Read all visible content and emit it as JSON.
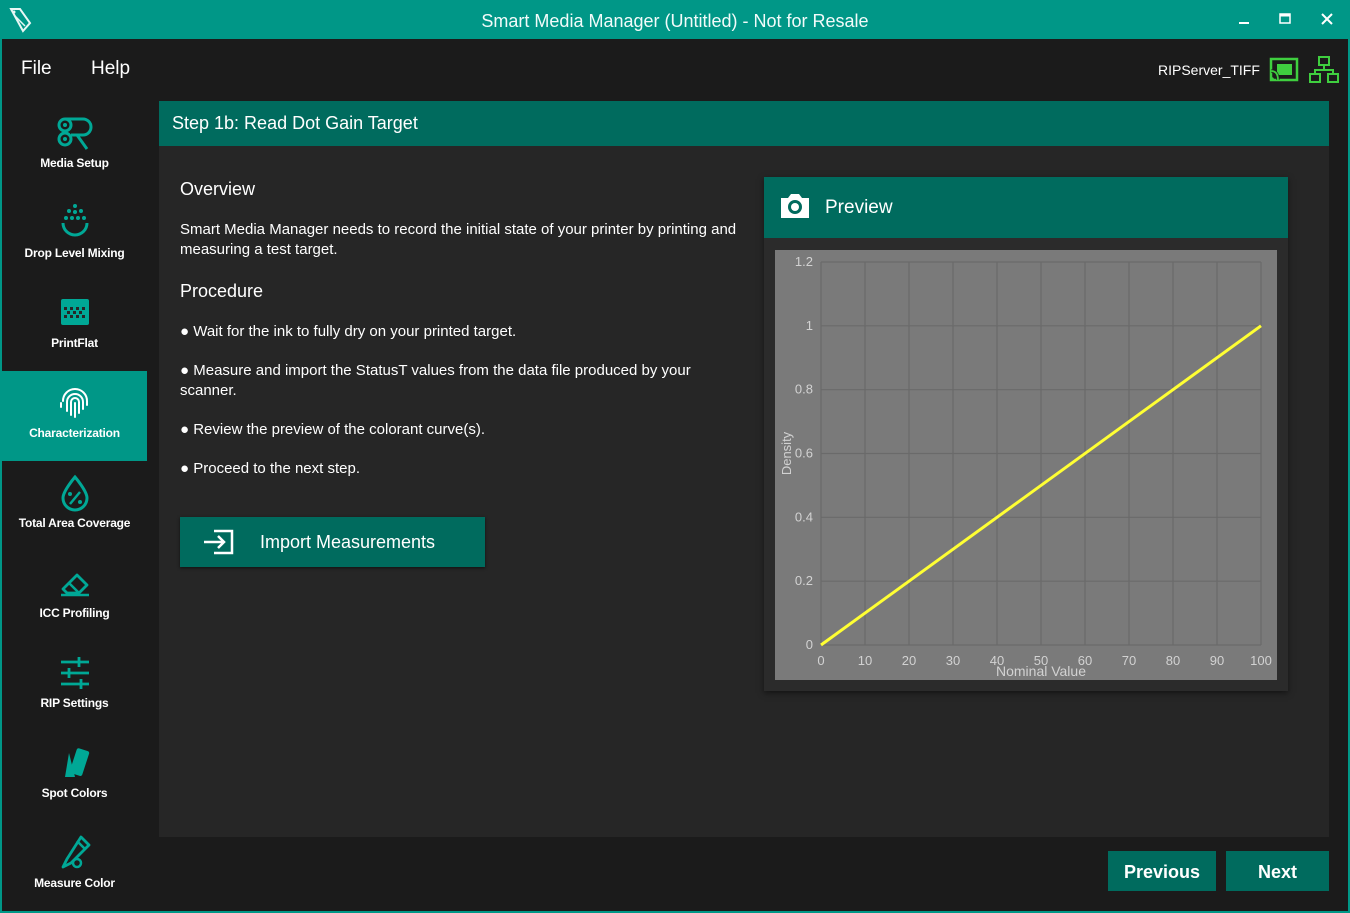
{
  "window": {
    "title": "Smart Media Manager (Untitled) - Not for Resale"
  },
  "menu": {
    "file": "File",
    "help": "Help"
  },
  "server": {
    "name": "RIPServer_TIFF"
  },
  "sidebar": {
    "items": [
      {
        "label": "Media Setup",
        "icon": "media-rolls-icon"
      },
      {
        "label": "Drop Level Mixing",
        "icon": "drop-mixing-icon"
      },
      {
        "label": "PrintFlat",
        "icon": "printflat-grid-icon"
      },
      {
        "label": "Characterization",
        "icon": "fingerprint-icon",
        "active": true
      },
      {
        "label": "Total Area Coverage",
        "icon": "ink-drop-percent-icon"
      },
      {
        "label": "ICC Profiling",
        "icon": "eraser-icon"
      },
      {
        "label": "RIP Settings",
        "icon": "sliders-icon"
      },
      {
        "label": "Spot Colors",
        "icon": "swatch-icon"
      },
      {
        "label": "Measure Color",
        "icon": "eyedropper-icon"
      }
    ]
  },
  "step": {
    "title": "Step 1b: Read Dot Gain Target"
  },
  "content": {
    "overview_title": "Overview",
    "overview_text": "Smart Media Manager needs to record the initial state of your printer by printing and measuring a test target.",
    "procedure_title": "Procedure",
    "steps": [
      "● Wait for the ink to fully dry on your printed target.",
      "● Measure and import the StatusT values from the data file produced by your scanner.",
      "● Review the preview of the colorant curve(s).",
      "● Proceed to the next step."
    ],
    "import_button": "Import Measurements"
  },
  "preview": {
    "title": "Preview"
  },
  "chart_data": {
    "type": "line",
    "xlabel": "Nominal Value",
    "ylabel": "Density",
    "xlim": [
      0,
      100
    ],
    "ylim": [
      0,
      1.2
    ],
    "x_ticks": [
      "0",
      "10",
      "20",
      "30",
      "40",
      "50",
      "60",
      "70",
      "80",
      "90",
      "100"
    ],
    "y_ticks": [
      "0",
      "0.2",
      "0.4",
      "0.6",
      "0.8",
      "1",
      "1.2"
    ],
    "grid": true,
    "series": [
      {
        "x": [
          0,
          100
        ],
        "y": [
          0,
          1.0
        ],
        "color": "#ffff33"
      }
    ]
  },
  "nav": {
    "previous": "Previous",
    "next": "Next"
  },
  "colors": {
    "accent": "#009787",
    "dark_accent": "#006b5e",
    "server_ok": "#3fcf3f"
  }
}
